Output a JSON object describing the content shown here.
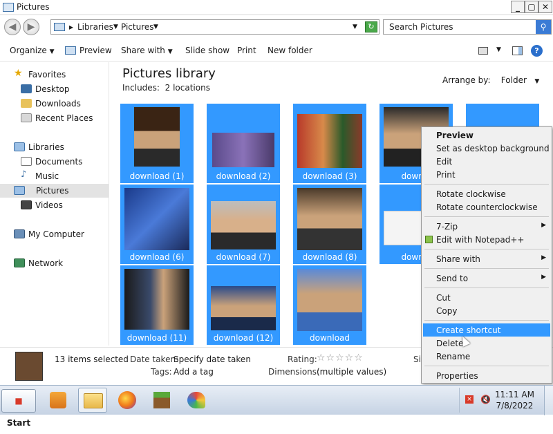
{
  "window": {
    "title": "Pictures",
    "minimize": "_",
    "maximize": "▢",
    "close": "✕"
  },
  "address": {
    "crumbs": [
      "Libraries",
      "Pictures"
    ],
    "search_placeholder": "Search Pictures"
  },
  "toolbar": {
    "organize": "Organize",
    "preview": "Preview",
    "share_with": "Share with",
    "slide_show": "Slide show",
    "print": "Print",
    "new_folder": "New folder"
  },
  "nav": {
    "favorites": "Favorites",
    "desktop": "Desktop",
    "downloads": "Downloads",
    "recent_places": "Recent Places",
    "libraries": "Libraries",
    "documents": "Documents",
    "music": "Music",
    "pictures": "Pictures",
    "videos": "Videos",
    "my_computer": "My Computer",
    "network": "Network"
  },
  "library": {
    "title": "Pictures library",
    "includes_label": "Includes:",
    "includes_value": "2 locations",
    "arrange_label": "Arrange by:",
    "arrange_value": "Folder"
  },
  "files": [
    {
      "name": "download (1)"
    },
    {
      "name": "download (2)"
    },
    {
      "name": "download (3)"
    },
    {
      "name": "downlo"
    },
    {
      "name": ""
    },
    {
      "name": "download (6)"
    },
    {
      "name": "download (7)"
    },
    {
      "name": "download (8)"
    },
    {
      "name": "downlo"
    },
    {
      "name": "download (11)"
    },
    {
      "name": "download (12)"
    },
    {
      "name": "download"
    }
  ],
  "details": {
    "selected": "13 items selected",
    "date_taken_label": "Date taken:",
    "date_taken_value": "Specify date taken",
    "tags_label": "Tags:",
    "tags_value": "Add a tag",
    "rating_label": "Rating:",
    "rating_stars": "☆☆☆☆☆",
    "dimensions_label": "Dimensions:",
    "dimensions_value": "(multiple values)",
    "size_label": "Si"
  },
  "context_menu": {
    "preview": "Preview",
    "set_desktop": "Set as desktop background",
    "edit": "Edit",
    "print": "Print",
    "rotate_cw": "Rotate clockwise",
    "rotate_ccw": "Rotate counterclockwise",
    "seven_zip": "7-Zip",
    "notepadpp": "Edit with Notepad++",
    "share_with": "Share with",
    "send_to": "Send to",
    "cut": "Cut",
    "copy": "Copy",
    "create_shortcut": "Create shortcut",
    "delete": "Delete",
    "rename": "Rename",
    "properties": "Properties"
  },
  "taskbar": {
    "start": "Start",
    "time": "11:11 AM",
    "date": "7/8/2022"
  },
  "colors": {
    "selection": "#3399ff",
    "menu_highlight": "#3399ff"
  }
}
